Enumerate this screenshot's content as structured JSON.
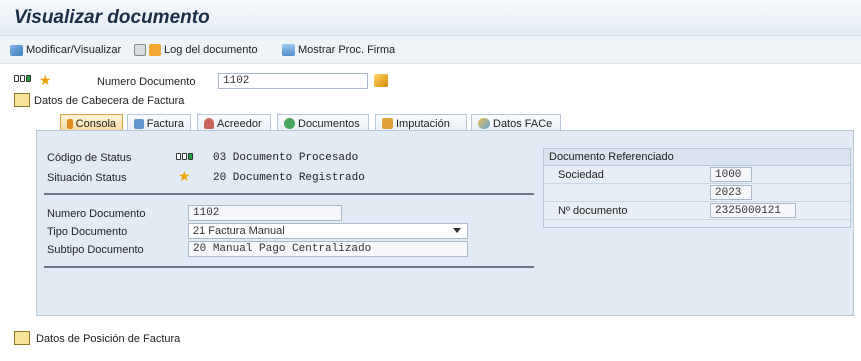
{
  "title": "Visualizar documento",
  "toolbar": {
    "modify_label": "Modificar/Visualizar",
    "log_label": "Log del documento",
    "firma_label": "Mostrar Proc. Firma"
  },
  "header": {
    "doc_number_label": "Numero Documento",
    "doc_number_value": "1102",
    "cabecera_label": "Datos de Cabecera de Factura"
  },
  "tabs": [
    {
      "label": "Consola"
    },
    {
      "label": "Factura"
    },
    {
      "label": "Acreedor"
    },
    {
      "label": "Documentos"
    },
    {
      "label": "Imputación"
    },
    {
      "label": "Datos FACe"
    }
  ],
  "consola": {
    "status_code_label": "Código de Status",
    "status_code_value": "03 Documento Procesado",
    "situacion_label": "Situación Status",
    "situacion_value": "20 Documento Registrado",
    "numero_label": "Numero Documento",
    "numero_value": "1102",
    "tipo_label": "Tipo Documento",
    "tipo_value": "21 Factura Manual",
    "subtipo_label": "Subtipo Documento",
    "subtipo_code": "20",
    "subtipo_value": "Manual Pago Centralizado"
  },
  "referenciado": {
    "title": "Documento Referenciado",
    "sociedad_label": "Sociedad",
    "sociedad_value": "1000",
    "year_value": "2023",
    "ndoc_label": "Nº documento",
    "ndoc_value": "2325000121"
  },
  "footer": {
    "posicion_label": "Datos de Posición de Factura"
  },
  "colors": {
    "accent_tab": "#f7d89a",
    "panel_bg": "#e2ebf3",
    "title_color": "#1c2f48"
  }
}
